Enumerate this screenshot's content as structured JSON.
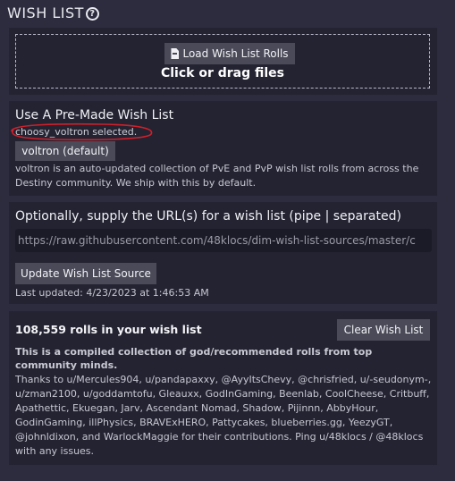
{
  "header": {
    "title": "WISH LIST"
  },
  "load_card": {
    "button_label": "Load Wish List Rolls",
    "drop_text": "Click or drag files"
  },
  "premade_card": {
    "title": "Use A Pre-Made Wish List",
    "selected_note": "choosy_voltron selected.",
    "voltron_button": "voltron (default)",
    "description": "voltron is an auto-updated collection of PvE and PvP wish list rolls from across the Destiny community. We ship with this by default."
  },
  "url_card": {
    "title": "Optionally, supply the URL(s) for a wish list (pipe | separated)",
    "url_value": "https://raw.githubusercontent.com/48klocs/dim-wish-list-sources/master/c",
    "update_button": "Update Wish List Source",
    "last_updated": "Last updated: 4/23/2023 at 1:46:53 AM"
  },
  "rolls_card": {
    "count_text": "108,559 rolls in your wish list",
    "clear_button": "Clear Wish List",
    "compiled_text": "This is a compiled collection of god/recommended rolls from top community minds.",
    "thanks_text": "Thanks to u/Mercules904, u/pandapaxxy, @AyyItsChevy, @chrisfried, u/-seudonym-, u/zman2100, u/goddamtofu, Gleauxx, GodInGaming, Beenlab, CoolCheese, Critbuff, Apathettic, Ekuegan, Jarv, Ascendant Nomad, Shadow, Pijinnn, AbbyHour, GodinGaming, illPhysics, BRAVExHERO, Pattycakes, blueberries.gg, YeezyGT, @johnldixon, and WarlockMaggie for their contributions. Ping u/48klocs / @48klocs with any issues."
  },
  "colors": {
    "background": "#2c2c3e",
    "card": "#232332",
    "button": "#4a4a58",
    "annotation": "#d0202a"
  }
}
